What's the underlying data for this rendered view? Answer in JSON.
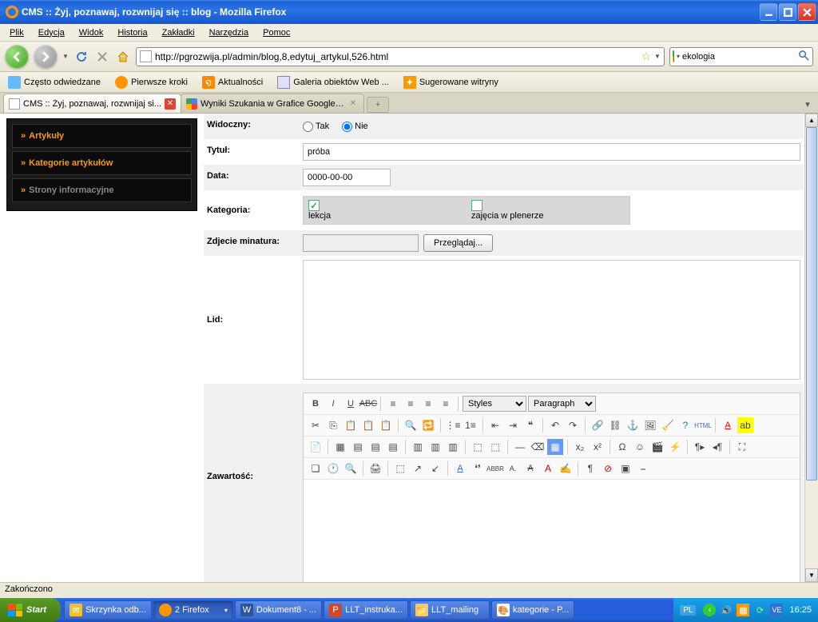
{
  "window": {
    "title": "CMS :: Żyj, poznawaj, rozwnijaj się :: blog - Mozilla Firefox"
  },
  "menu": {
    "file": "Plik",
    "edit": "Edycja",
    "view": "Widok",
    "history": "Historia",
    "bookmarks": "Zakładki",
    "tools": "Narzędzia",
    "help": "Pomoc"
  },
  "url": "http://pgrozwija.pl/admin/blog,8,edytuj_artykul,526.html",
  "search": {
    "value": "ekologia"
  },
  "bookmarks": {
    "b1": "Często odwiedzane",
    "b2": "Pierwsze kroki",
    "b3": "Aktualności",
    "b4": "Galeria obiektów Web ...",
    "b5": "Sugerowane witryny"
  },
  "tabs": {
    "t1": "CMS :: Żyj, poznawaj, rozwnijaj si...",
    "t2": "Wyniki Szukania w Grafice Google dla h..."
  },
  "side": {
    "m1": "Artykuły",
    "m2": "Kategorie artykułów",
    "m3": "Strony informacyjne"
  },
  "form": {
    "visible_lbl": "Widoczny:",
    "tak": "Tak",
    "nie": "Nie",
    "title_lbl": "Tytuł:",
    "title_val": "próba",
    "date_lbl": "Data:",
    "date_val": "0000-00-00",
    "cat_lbl": "Kategoria:",
    "cat1": "lekcja",
    "cat2": "zajęcia w plenerze",
    "thumb_lbl": "Zdjecie minatura:",
    "browse": "Przeglądaj...",
    "lid_lbl": "Lid:",
    "content_lbl": "Zawartość:",
    "styles": "Styles",
    "paragraph": "Paragraph"
  },
  "status": "Zakończono",
  "taskbar": {
    "start": "Start",
    "t1": "Skrzynka odb...",
    "t2": "2 Firefox",
    "t3": "Dokument8 - ...",
    "t4": "LLT_instruka...",
    "t5": "LLT_mailing",
    "t6": "kategorie - P...",
    "lang": "PL",
    "clock": "16:25"
  }
}
